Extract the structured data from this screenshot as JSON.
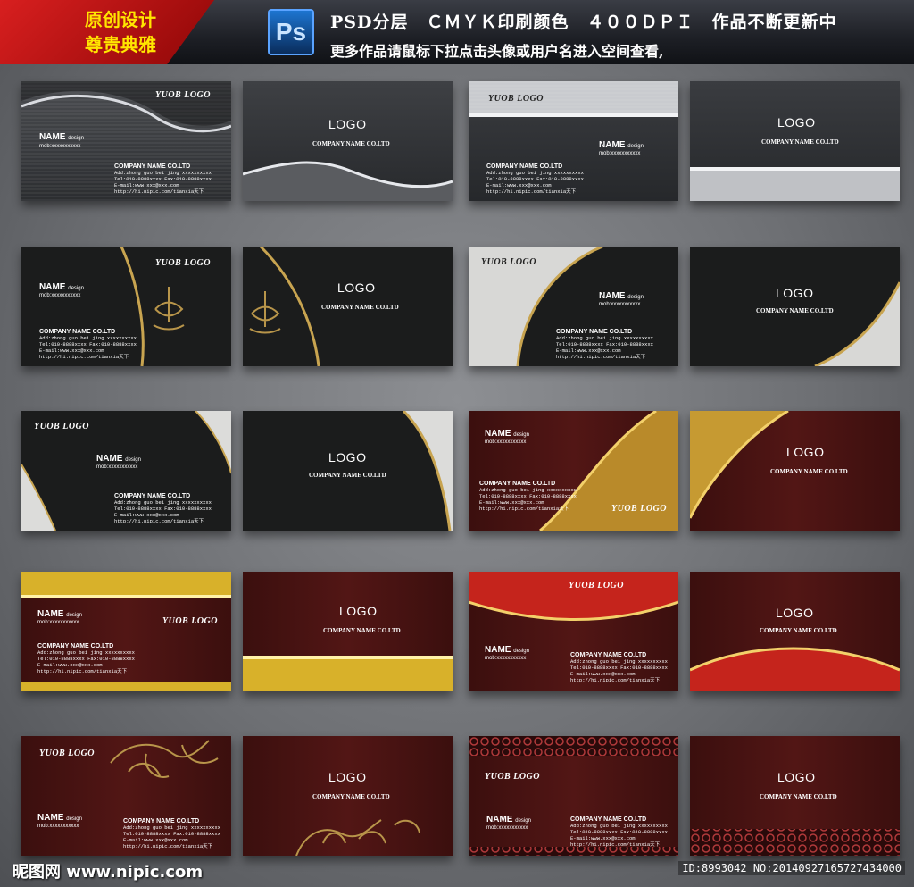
{
  "banner": {
    "badge_line1": "原创设计",
    "badge_line2": "尊贵典雅",
    "ps_label": "Ps",
    "line1": "PSD分层　ＣＭＹＫ印刷颜色　４００ＤＰＩ　作品不断更新中",
    "line2": "更多作品请鼠标下拉点击头像或用户名进入空间查看,"
  },
  "card_text": {
    "logo_script": "YUOB LOGO",
    "logo": "LOGO",
    "company": "COMPANY NAME CO.LTD",
    "name": "NAME",
    "design": "design",
    "mob": "mob:xxxxxxxxxxx",
    "company_upper": "COMPANY NAME CO.LTD",
    "add": "Add:zhong guo bei jing xxxxxxxxxx",
    "tel": "Tel:010-8888xxxx Fax:010-8888xxxx",
    "email": "E-mail:www.xxx@xxx.com",
    "http": "http://hi.nipic.com/tianxia天下"
  },
  "footer": {
    "left": "昵图网 www.nipic.com",
    "right": "ID:8993042 NO:20140927165727434000"
  }
}
